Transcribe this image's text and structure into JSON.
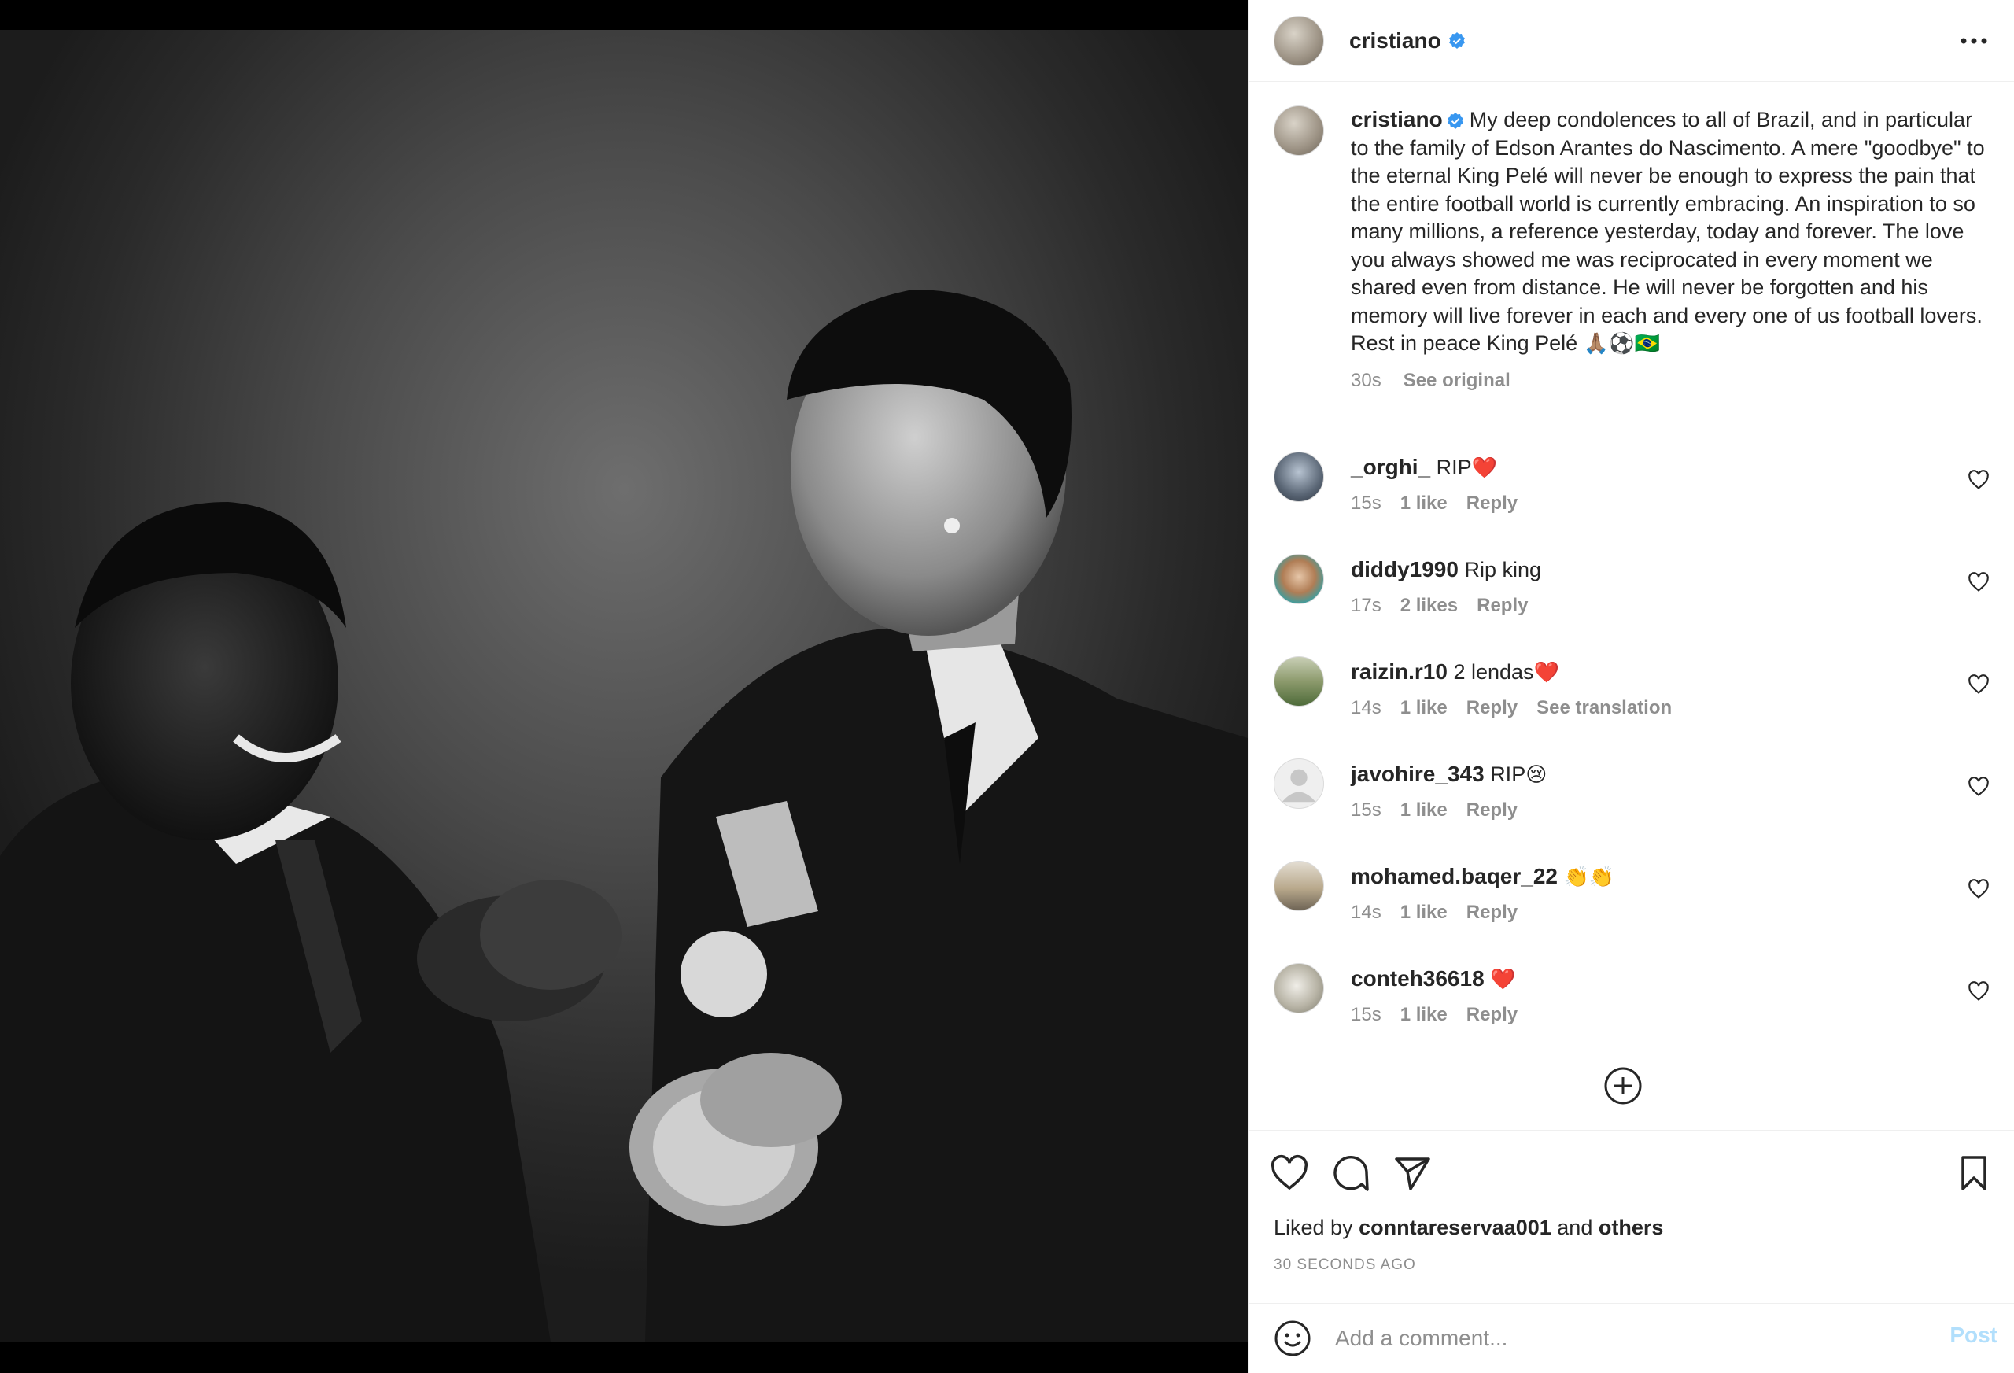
{
  "post": {
    "author": "cristiano",
    "verified": true,
    "caption": "My deep condolences to all of Brazil, and in particular to the family of Edson Arantes do Nascimento. A mere \"goodbye\" to the eternal King Pelé will never be enough to express the pain that the entire football world is currently embracing. An inspiration to so many millions, a reference yesterday, today and forever. The love you always showed me was reciprocated in every moment we shared even from distance. He will never be forgotten and his memory will live forever in each and every one of us football lovers. Rest in peace King Pelé",
    "caption_emojis": "🙏🏽⚽🇧🇷",
    "caption_time": "30s",
    "see_original": "See original"
  },
  "comments": [
    {
      "user": "_orghi_",
      "text": "RIP",
      "emoji": "❤️",
      "time": "15s",
      "likes": "1 like",
      "reply": "Reply",
      "extra": ""
    },
    {
      "user": "diddy1990",
      "text": "Rip king",
      "emoji": "",
      "time": "17s",
      "likes": "2 likes",
      "reply": "Reply",
      "extra": ""
    },
    {
      "user": "raizin.r10",
      "text": "2 lendas",
      "emoji": "❤️",
      "time": "14s",
      "likes": "1 like",
      "reply": "Reply",
      "extra": "See translation"
    },
    {
      "user": "javohire_343",
      "text": "RIP",
      "emoji": "😢",
      "time": "15s",
      "likes": "1 like",
      "reply": "Reply",
      "extra": ""
    },
    {
      "user": "mohamed.baqer_22",
      "text": "",
      "emoji": "👏👏",
      "time": "14s",
      "likes": "1 like",
      "reply": "Reply",
      "extra": ""
    },
    {
      "user": "conteh36618",
      "text": "",
      "emoji": "❤️",
      "time": "15s",
      "likes": "1 like",
      "reply": "Reply",
      "extra": ""
    }
  ],
  "likes": {
    "prefix": "Liked by",
    "user": "conntareservaa001",
    "and": "and",
    "others": "others"
  },
  "timestamp": "30 SECONDS AGO",
  "add_comment": {
    "placeholder": "Add a comment...",
    "post_label": "Post"
  },
  "icons": {
    "more": "more-options-icon",
    "like": "heart-icon",
    "comment": "comment-icon",
    "share": "share-icon",
    "save": "bookmark-icon",
    "load_more": "plus-circle-icon",
    "emoji": "emoji-icon",
    "verified": "verified-badge-icon"
  },
  "colors": {
    "verified": "#3897f0",
    "muted": "#8e8e8e",
    "post_disabled": "#b2dffc",
    "heart_red": "#ed4956"
  }
}
